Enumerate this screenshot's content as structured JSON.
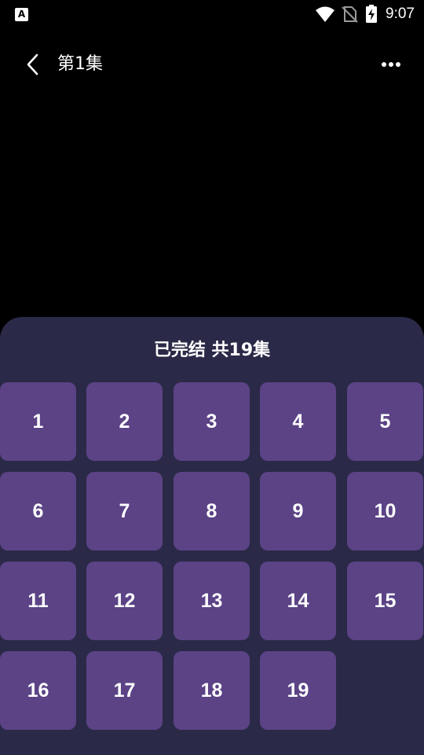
{
  "status_bar": {
    "app_icon_letter": "A",
    "time": "9:07"
  },
  "header": {
    "title": "第1集"
  },
  "sheet": {
    "title": "已完结 共19集",
    "episodes": [
      "1",
      "2",
      "3",
      "4",
      "5",
      "6",
      "7",
      "8",
      "9",
      "10",
      "11",
      "12",
      "13",
      "14",
      "15",
      "16",
      "17",
      "18",
      "19"
    ]
  },
  "colors": {
    "background": "#000000",
    "sheet_background": "#2a2947",
    "tile_background": "#5b4386",
    "text": "#ffffff"
  }
}
